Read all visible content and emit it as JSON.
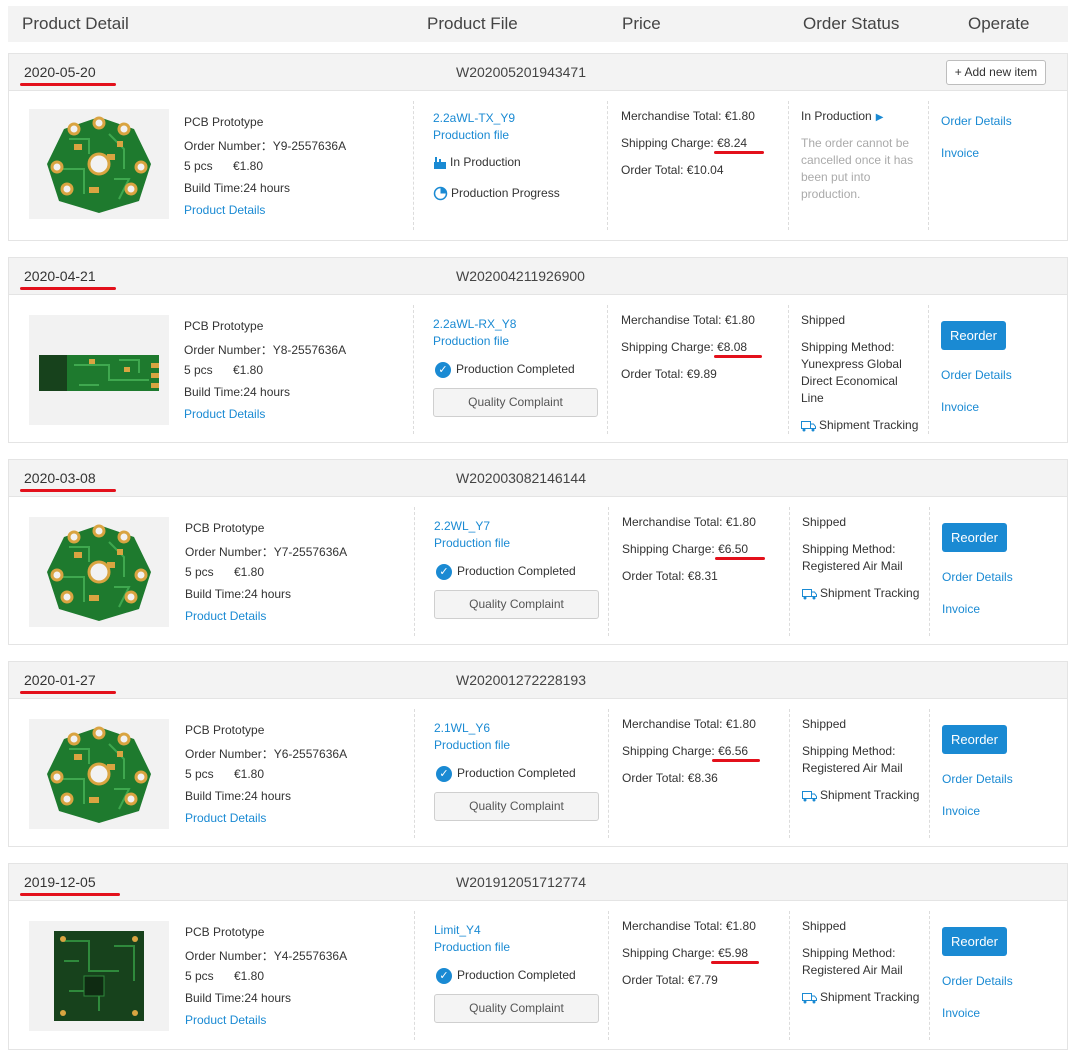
{
  "columns": {
    "product_detail": "Product Detail",
    "product_file": "Product File",
    "price": "Price",
    "order_status": "Order Status",
    "operate": "Operate"
  },
  "add_new_item": "+ Add new item",
  "orders": [
    {
      "date": "2020-05-20",
      "order_no": "W202005201943471",
      "product_name": "PCB Prototype",
      "order_number": "Order Number：Y9-2557636A",
      "qty": "5 pcs",
      "unit_price": "€1.80",
      "build_time": "Build Time:24 hours",
      "product_details": "Product Details",
      "file_name": "2.2aWL-TX_Y9",
      "production_file": "Production file",
      "production_state": "In Production",
      "production_progress": "Production Progress",
      "merchandise_total": "Merchandise Total: €1.80",
      "shipping_charge_label": "Shipping Charge: ",
      "shipping_charge": "€8.24",
      "order_total": "Order Total: €10.04",
      "status": "In Production",
      "status_note_1": "The order cannot be",
      "status_note_2": "cancelled once it has",
      "status_note_3": "been put into",
      "status_note_4": "production.",
      "order_details": "Order Details",
      "invoice": "Invoice"
    },
    {
      "date": "2020-04-21",
      "order_no": "W202004211926900",
      "product_name": "PCB Prototype",
      "order_number": "Order Number：Y8-2557636A",
      "qty": "5 pcs",
      "unit_price": "€1.80",
      "build_time": "Build Time:24 hours",
      "product_details": "Product Details",
      "file_name": "2.2aWL-RX_Y8",
      "production_file": "Production file",
      "production_state": "Production Completed",
      "quality_complaint": "Quality Complaint",
      "merchandise_total": "Merchandise Total: €1.80",
      "shipping_charge_label": "Shipping Charge: ",
      "shipping_charge": "€8.08",
      "order_total": "Order Total: €9.89",
      "status": "Shipped",
      "method_1": "Shipping Method:",
      "method_2": "Yunexpress Global",
      "method_3": "Direct Economical",
      "method_4": "Line",
      "shipment_tracking": "Shipment Tracking",
      "reorder": "Reorder",
      "order_details": "Order Details",
      "invoice": "Invoice"
    },
    {
      "date": "2020-03-08",
      "order_no": "W202003082146144",
      "product_name": "PCB Prototype",
      "order_number": "Order Number：Y7-2557636A",
      "qty": "5 pcs",
      "unit_price": "€1.80",
      "build_time": "Build Time:24 hours",
      "product_details": "Product Details",
      "file_name": "2.2WL_Y7",
      "production_file": "Production file",
      "production_state": "Production Completed",
      "quality_complaint": "Quality Complaint",
      "merchandise_total": "Merchandise Total: €1.80",
      "shipping_charge_label": "Shipping Charge: ",
      "shipping_charge": "€6.50",
      "order_total": "Order Total: €8.31",
      "status": "Shipped",
      "method_1": "Shipping Method:",
      "method_2": "Registered Air Mail",
      "shipment_tracking": "Shipment Tracking",
      "reorder": "Reorder",
      "order_details": "Order Details",
      "invoice": "Invoice"
    },
    {
      "date": "2020-01-27",
      "order_no": "W202001272228193",
      "product_name": "PCB Prototype",
      "order_number": "Order Number：Y6-2557636A",
      "qty": "5 pcs",
      "unit_price": "€1.80",
      "build_time": "Build Time:24 hours",
      "product_details": "Product Details",
      "file_name": "2.1WL_Y6",
      "production_file": "Production file",
      "production_state": "Production Completed",
      "quality_complaint": "Quality Complaint",
      "merchandise_total": "Merchandise Total: €1.80",
      "shipping_charge_label": "Shipping Charge: ",
      "shipping_charge": "€6.56",
      "order_total": "Order Total: €8.36",
      "status": "Shipped",
      "method_1": "Shipping Method:",
      "method_2": "Registered Air Mail",
      "shipment_tracking": "Shipment Tracking",
      "reorder": "Reorder",
      "order_details": "Order Details",
      "invoice": "Invoice"
    },
    {
      "date": "2019-12-05",
      "order_no": "W201912051712774",
      "product_name": "PCB Prototype",
      "order_number": "Order Number：Y4-2557636A",
      "qty": "5 pcs",
      "unit_price": "€1.80",
      "build_time": "Build Time:24 hours",
      "product_details": "Product Details",
      "file_name": "Limit_Y4",
      "production_file": "Production file",
      "production_state": "Production Completed",
      "quality_complaint": "Quality Complaint",
      "merchandise_total": "Merchandise Total: €1.80",
      "shipping_charge_label": "Shipping Charge: ",
      "shipping_charge": "€5.98",
      "order_total": "Order Total: €7.79",
      "status": "Shipped",
      "method_1": "Shipping Method:",
      "method_2": "Registered Air Mail",
      "shipment_tracking": "Shipment Tracking",
      "reorder": "Reorder",
      "order_details": "Order Details",
      "invoice": "Invoice"
    }
  ],
  "colors": {
    "link": "#1a8ad3",
    "highlight": "#e3101b",
    "pcb_green": "#1e7a2e",
    "pcb_pad": "#d9a441"
  },
  "icons": {
    "round_pcb": "round-pcb-image",
    "strip_pcb": "strip-pcb-image",
    "square_pcb": "square-pcb-image",
    "check": "check-circle-icon",
    "truck": "truck-icon",
    "factory": "factory-icon",
    "progress": "progress-icon",
    "play": "play-triangle-icon"
  }
}
